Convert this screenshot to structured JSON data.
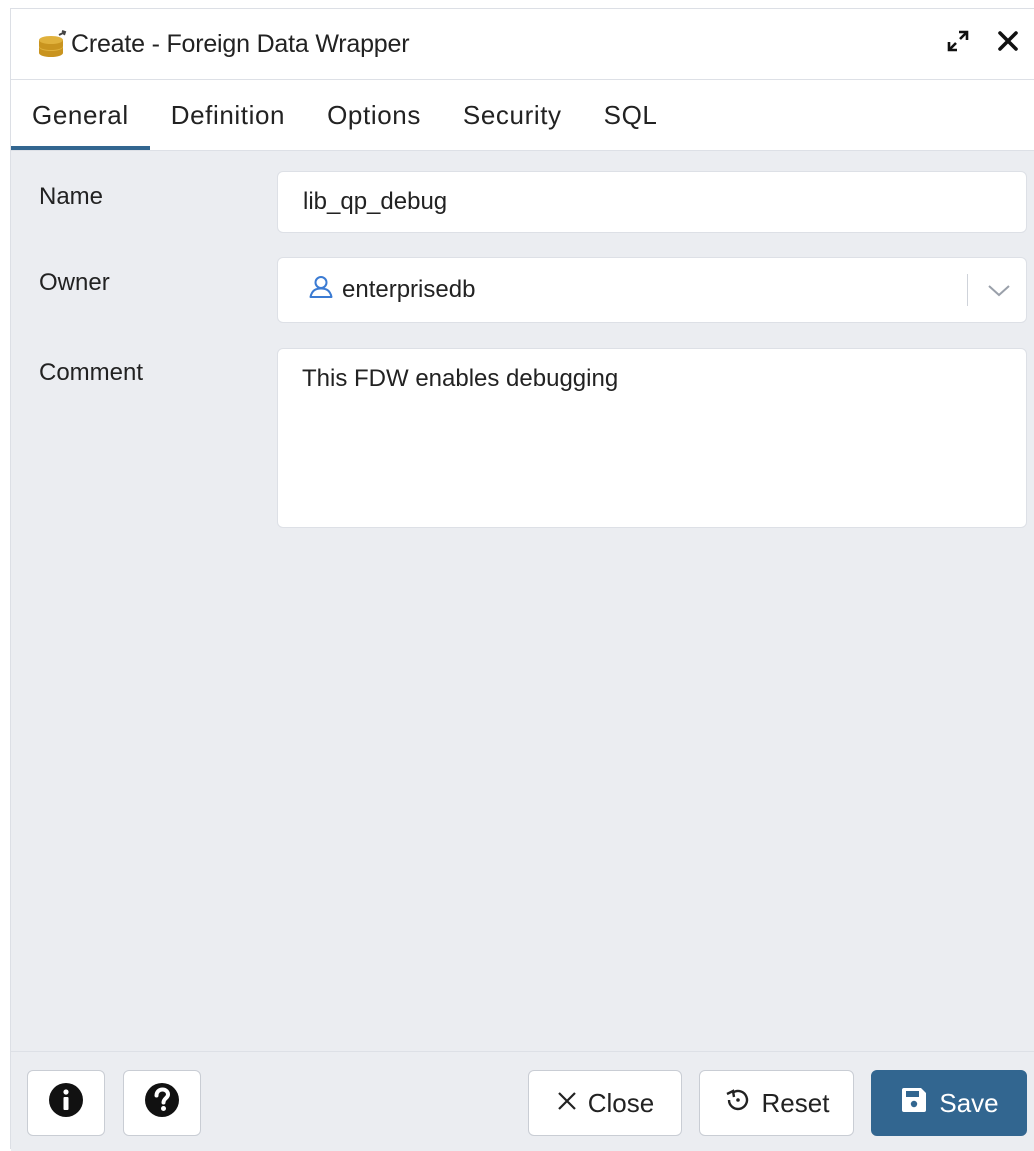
{
  "dialog": {
    "title": "Create - Foreign Data Wrapper",
    "title_icon": "database-stack-icon",
    "actions": {
      "maximize_icon": "expand-arrows-icon",
      "close_icon": "close-x-icon"
    }
  },
  "tabs": [
    {
      "label": "General",
      "active": true
    },
    {
      "label": "Definition",
      "active": false
    },
    {
      "label": "Options",
      "active": false
    },
    {
      "label": "Security",
      "active": false
    },
    {
      "label": "SQL",
      "active": false
    }
  ],
  "form": {
    "name": {
      "label": "Name",
      "value": "lib_qp_debug"
    },
    "owner": {
      "label": "Owner",
      "value": "enterprisedb",
      "icon": "user-icon"
    },
    "comment": {
      "label": "Comment",
      "value": "This FDW enables debugging"
    }
  },
  "footer": {
    "info_icon": "info-circle-icon",
    "help_icon": "question-circle-icon",
    "close_label": "Close",
    "reset_label": "Reset",
    "save_label": "Save"
  },
  "colors": {
    "accent": "#326690",
    "background": "#ebedf1",
    "user_icon": "#3b7bd3",
    "db_icon": "#d8a832"
  }
}
